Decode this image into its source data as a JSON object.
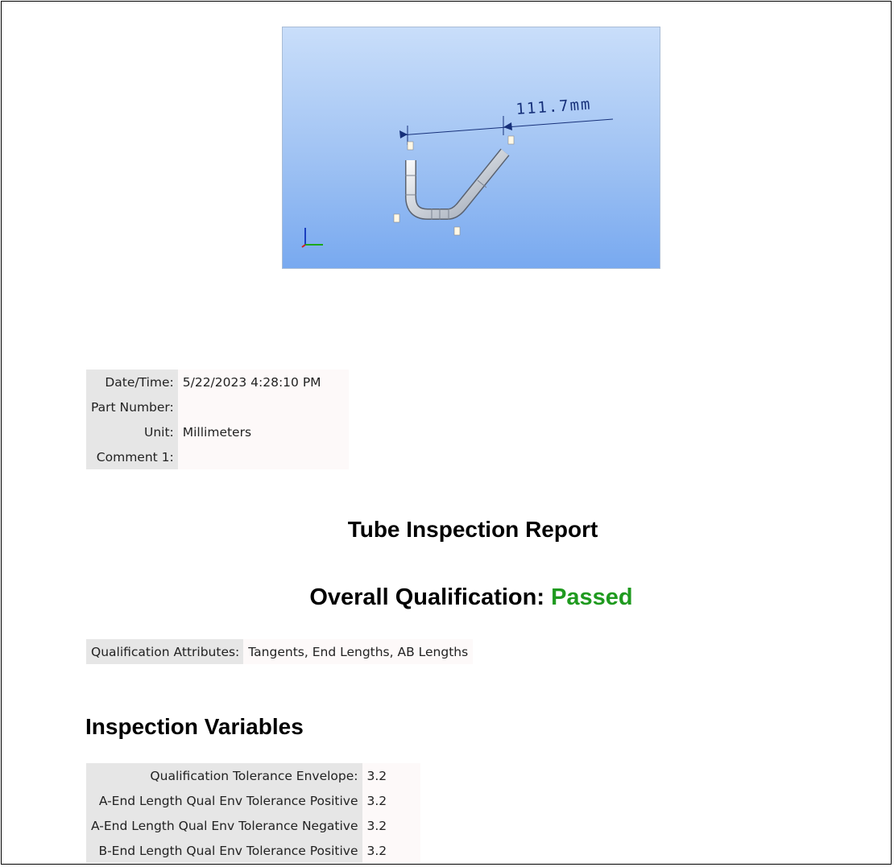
{
  "viewport": {
    "dimension_label": "111.7mm",
    "colors": {
      "background_top": "#c9defa",
      "background_bottom": "#78a9f0",
      "dimension": "#16307a"
    }
  },
  "header_info": {
    "rows": [
      {
        "label": "Date/Time:",
        "value": "5/22/2023 4:28:10 PM"
      },
      {
        "label": "Part Number:",
        "value": ""
      },
      {
        "label": "Unit:",
        "value": "Millimeters"
      },
      {
        "label": "Comment 1:",
        "value": ""
      }
    ]
  },
  "report": {
    "title": "Tube Inspection Report",
    "overall_label": "Overall Qualification:",
    "overall_status": "Passed",
    "status_color": "#1f9a1f"
  },
  "qualification": {
    "label": "Qualification Attributes:",
    "value": "Tangents, End Lengths, AB Lengths"
  },
  "inspection_variables": {
    "heading": "Inspection Variables",
    "rows": [
      {
        "label": "Qualification Tolerance Envelope:",
        "value": "3.2"
      },
      {
        "label": "A-End Length Qual Env Tolerance Positive",
        "value": "3.2"
      },
      {
        "label": "A-End Length Qual Env Tolerance Negative",
        "value": "3.2"
      },
      {
        "label": "B-End Length Qual Env Tolerance Positive",
        "value": "3.2"
      }
    ]
  }
}
